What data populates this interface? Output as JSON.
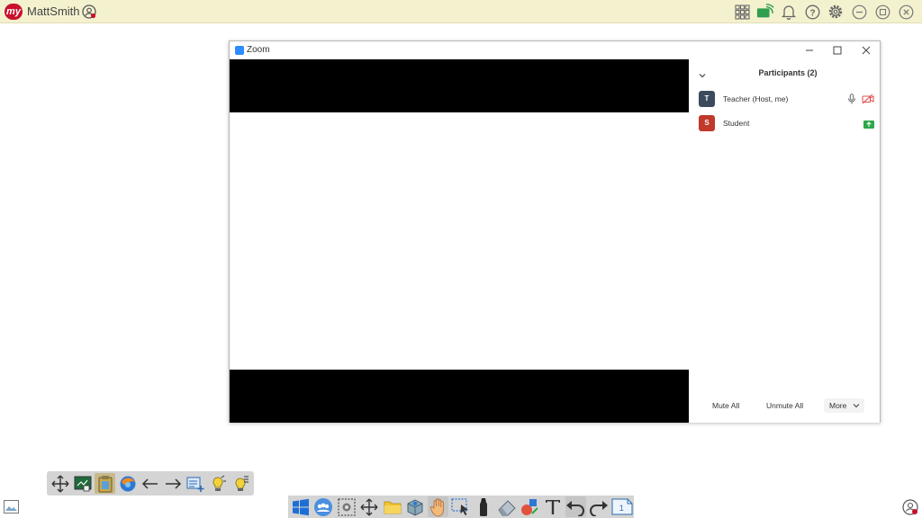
{
  "topbar": {
    "logo_text": "my",
    "username": "MattSmith",
    "icons": [
      "apps-grid-icon",
      "cast-icon",
      "bell-icon",
      "help-icon",
      "gear-icon",
      "minimize-icon",
      "restore-icon",
      "close-icon"
    ]
  },
  "zoom": {
    "title": "Zoom",
    "participants": {
      "title": "Participants (2)",
      "items": [
        {
          "initial": "T",
          "name": "Teacher (Host, me)",
          "color": "#3b4a5c",
          "icons": [
            "microphone-icon",
            "video-off-icon"
          ]
        },
        {
          "initial": "S",
          "name": "Student",
          "color": "#c0392b",
          "icons": [
            "screen-share-icon"
          ]
        }
      ],
      "buttons": {
        "mute_all": "Mute All",
        "unmute_all": "Unmute All",
        "more": "More"
      }
    }
  },
  "left_toolbar": {
    "tools": [
      "move-icon",
      "whiteboard-icon",
      "clipboard-icon",
      "browser-icon",
      "back-arrow-icon",
      "forward-arrow-icon",
      "add-note-icon",
      "spotlight-icon",
      "pen-tool-icon"
    ],
    "active": "clipboard-icon"
  },
  "taskbar": {
    "tools": [
      "windows-icon",
      "group-icon",
      "screen-capture-icon",
      "move-icon",
      "folder-icon",
      "box-icon",
      "hand-icon",
      "select-icon",
      "marker-icon",
      "eraser-icon",
      "shapes-icon",
      "text-icon",
      "undo-icon",
      "redo-icon",
      "page-icon"
    ],
    "page_number": "1"
  },
  "colors": {
    "topbar_bg": "#f4f1cf",
    "logo": "#c8102e",
    "toolbar_bg": "#d4d4d4",
    "zoom_blue": "#2d8cff"
  }
}
